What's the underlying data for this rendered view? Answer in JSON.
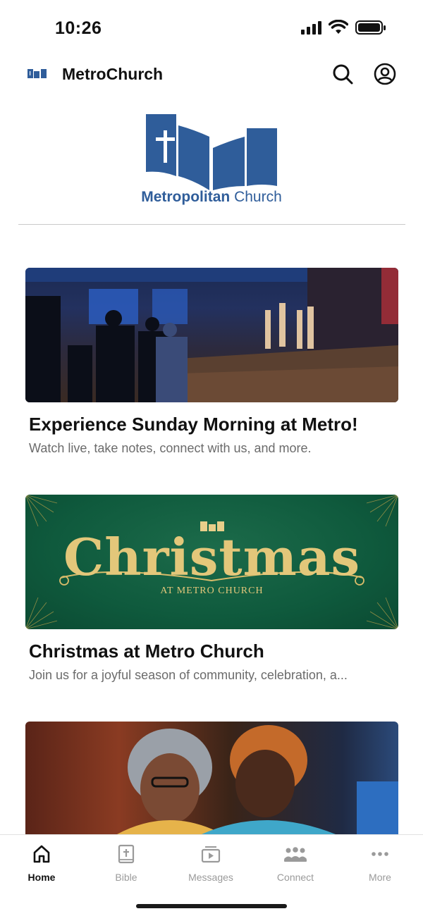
{
  "status": {
    "time": "10:26"
  },
  "header": {
    "title": "MetroChurch"
  },
  "brand": {
    "name_bold": "Metropolitan",
    "name_light": "Church",
    "color": "#2f5d9a"
  },
  "cards": [
    {
      "title": "Experience Sunday Morning at Metro!",
      "subtitle": "Watch live, take notes, connect with us, and more."
    },
    {
      "title": "Christmas at Metro Church",
      "subtitle": "Join us for a joyful season of community, celebration, a...",
      "banner_title": "Christmas",
      "banner_sub": "AT METRO CHURCH"
    },
    {
      "title": "",
      "subtitle": ""
    }
  ],
  "tabs": [
    {
      "label": "Home",
      "icon": "home-icon",
      "active": true
    },
    {
      "label": "Bible",
      "icon": "bible-icon",
      "active": false
    },
    {
      "label": "Messages",
      "icon": "messages-icon",
      "active": false
    },
    {
      "label": "Connect",
      "icon": "connect-icon",
      "active": false
    },
    {
      "label": "More",
      "icon": "more-icon",
      "active": false
    }
  ]
}
